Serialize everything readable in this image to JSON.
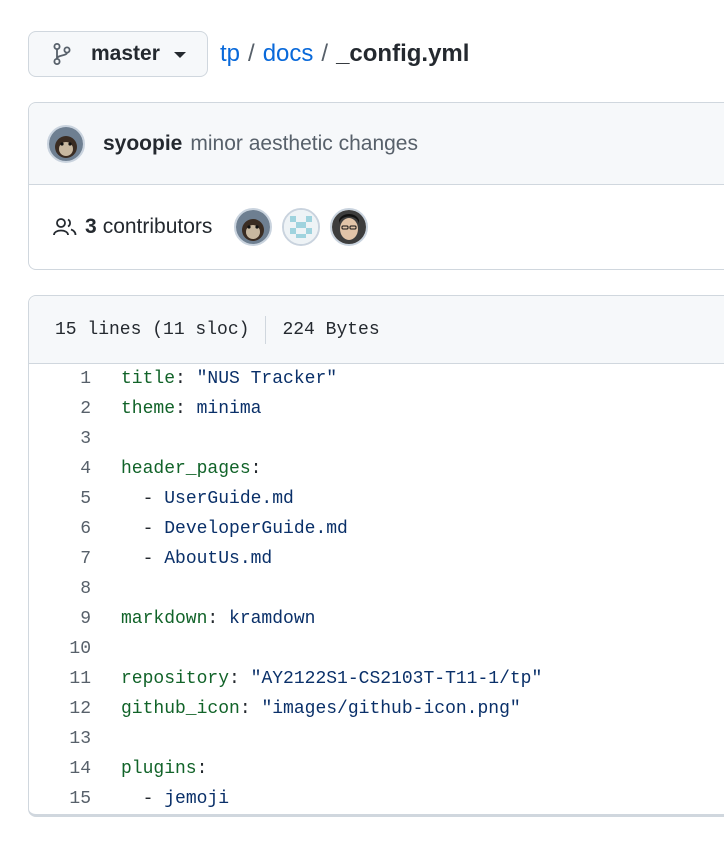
{
  "branch": {
    "name": "master",
    "icon": "git-branch-icon"
  },
  "breadcrumb": {
    "repo": "tp",
    "folder": "docs",
    "separator": "/",
    "file": "_config.yml"
  },
  "commit": {
    "author": "syoopie",
    "message": "minor aesthetic changes"
  },
  "contributors": {
    "count": "3",
    "label": "contributors",
    "icon": "people-icon"
  },
  "file_info": {
    "lines": "15 lines (11 sloc)",
    "size": "224 Bytes"
  },
  "code": {
    "lines": [
      {
        "num": "1",
        "key": "title",
        "punct": ": ",
        "value": "\"NUS Tracker\""
      },
      {
        "num": "2",
        "key": "theme",
        "punct": ": ",
        "value": "minima"
      },
      {
        "num": "3",
        "key": "",
        "punct": "",
        "value": ""
      },
      {
        "num": "4",
        "key": "header_pages",
        "punct": ":",
        "value": ""
      },
      {
        "num": "5",
        "key": "",
        "punct": "  - ",
        "value": "UserGuide.md"
      },
      {
        "num": "6",
        "key": "",
        "punct": "  - ",
        "value": "DeveloperGuide.md"
      },
      {
        "num": "7",
        "key": "",
        "punct": "  - ",
        "value": "AboutUs.md"
      },
      {
        "num": "8",
        "key": "",
        "punct": "",
        "value": ""
      },
      {
        "num": "9",
        "key": "markdown",
        "punct": ": ",
        "value": "kramdown"
      },
      {
        "num": "10",
        "key": "",
        "punct": "",
        "value": ""
      },
      {
        "num": "11",
        "key": "repository",
        "punct": ": ",
        "value": "\"AY2122S1-CS2103T-T11-1/tp\""
      },
      {
        "num": "12",
        "key": "github_icon",
        "punct": ": ",
        "value": "\"images/github-icon.png\""
      },
      {
        "num": "13",
        "key": "",
        "punct": "",
        "value": ""
      },
      {
        "num": "14",
        "key": "plugins",
        "punct": ":",
        "value": ""
      },
      {
        "num": "15",
        "key": "",
        "punct": "  - ",
        "value": "jemoji"
      }
    ]
  },
  "colors": {
    "link": "#0969da",
    "key": "#116329",
    "value": "#0a3069",
    "border": "#d0d7de",
    "header_bg": "#f6f8fa"
  }
}
